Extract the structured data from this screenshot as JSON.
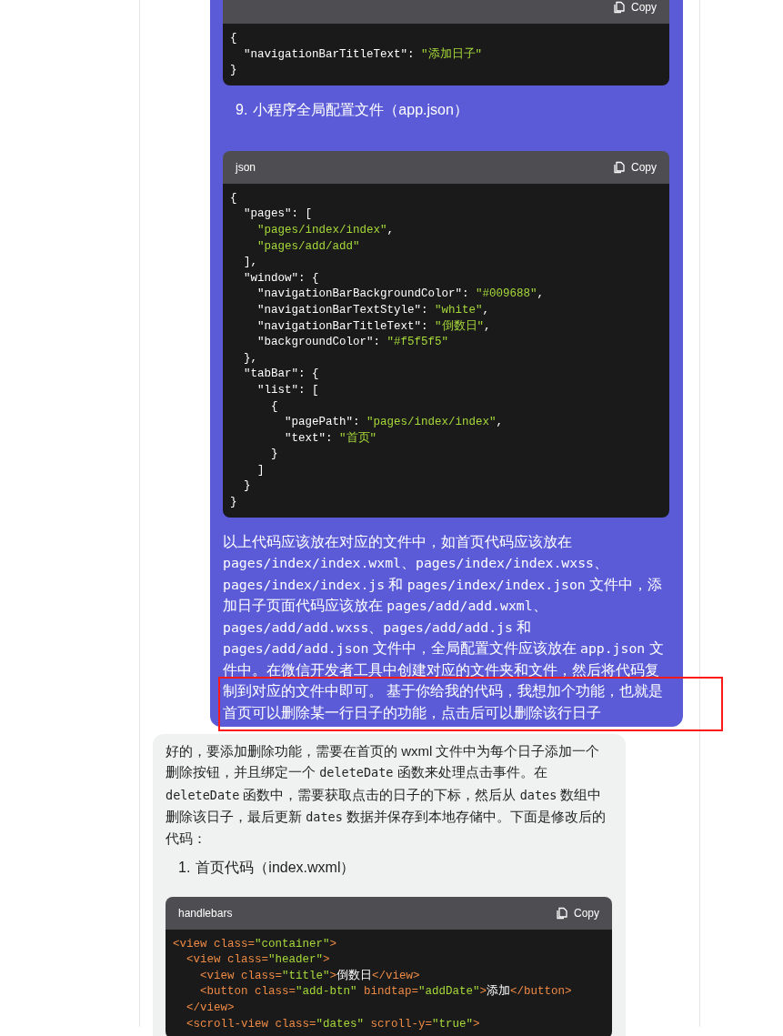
{
  "user_message": {
    "blocks": [
      {
        "kind": "code",
        "copy_label": "Copy",
        "lines": [
          [
            {
              "kind": "plain",
              "text": "{"
            }
          ],
          [
            {
              "kind": "plain",
              "text": "  \"navigationBarTitleText\": "
            },
            {
              "kind": "string",
              "text": "\"添加日子\""
            }
          ],
          [
            {
              "kind": "plain",
              "text": "}"
            }
          ]
        ]
      },
      {
        "kind": "list_item",
        "number": "9.",
        "text": "小程序全局配置文件（app.json）"
      },
      {
        "kind": "code",
        "language": "json",
        "copy_label": "Copy",
        "lines": [
          [
            {
              "kind": "plain",
              "text": "{"
            }
          ],
          [
            {
              "kind": "plain",
              "text": "  \"pages\": ["
            }
          ],
          [
            {
              "kind": "string",
              "text": "    \"pages/index/index\""
            },
            {
              "kind": "plain",
              "text": ","
            }
          ],
          [
            {
              "kind": "string",
              "text": "    \"pages/add/add\""
            }
          ],
          [
            {
              "kind": "plain",
              "text": "  ],"
            }
          ],
          [
            {
              "kind": "plain",
              "text": "  \"window\": {"
            }
          ],
          [
            {
              "kind": "plain",
              "text": "    \"navigationBarBackgroundColor\": "
            },
            {
              "kind": "string",
              "text": "\"#009688\""
            },
            {
              "kind": "plain",
              "text": ","
            }
          ],
          [
            {
              "kind": "plain",
              "text": "    \"navigationBarTextStyle\": "
            },
            {
              "kind": "string",
              "text": "\"white\""
            },
            {
              "kind": "plain",
              "text": ","
            }
          ],
          [
            {
              "kind": "plain",
              "text": "    \"navigationBarTitleText\": "
            },
            {
              "kind": "string",
              "text": "\"倒数日\""
            },
            {
              "kind": "plain",
              "text": ","
            }
          ],
          [
            {
              "kind": "plain",
              "text": "    \"backgroundColor\": "
            },
            {
              "kind": "string",
              "text": "\"#f5f5f5\""
            }
          ],
          [
            {
              "kind": "plain",
              "text": "  },"
            }
          ],
          [
            {
              "kind": "plain",
              "text": "  \"tabBar\": {"
            }
          ],
          [
            {
              "kind": "plain",
              "text": "    \"list\": ["
            }
          ],
          [
            {
              "kind": "plain",
              "text": "      {"
            }
          ],
          [
            {
              "kind": "plain",
              "text": "        \"pagePath\": "
            },
            {
              "kind": "string",
              "text": "\"pages/index/index\""
            },
            {
              "kind": "plain",
              "text": ","
            }
          ],
          [
            {
              "kind": "plain",
              "text": "        \"text\": "
            },
            {
              "kind": "string",
              "text": "\"首页\""
            }
          ],
          [
            {
              "kind": "plain",
              "text": "      }"
            }
          ],
          [
            {
              "kind": "plain",
              "text": "    ]"
            }
          ],
          [
            {
              "kind": "plain",
              "text": "  }"
            }
          ],
          [
            {
              "kind": "plain",
              "text": "}"
            }
          ]
        ]
      },
      {
        "kind": "paragraph",
        "segments": [
          {
            "kind": "text",
            "text": "以上代码应该放在对应的文件中，如首页代码应该放在 "
          },
          {
            "kind": "code",
            "text": "pages/index/index.wxml"
          },
          {
            "kind": "text",
            "text": "、"
          },
          {
            "kind": "code",
            "text": "pages/index/index.wxss"
          },
          {
            "kind": "text",
            "text": "、"
          },
          {
            "kind": "code",
            "text": "pages/index/index.js"
          },
          {
            "kind": "text",
            "text": " 和 "
          },
          {
            "kind": "code",
            "text": "pages/index/index.json"
          },
          {
            "kind": "text",
            "text": " 文件中，添加日子页面代码应该放在 "
          },
          {
            "kind": "code",
            "text": "pages/add/add.wxml"
          },
          {
            "kind": "text",
            "text": "、"
          },
          {
            "kind": "code",
            "text": "pages/add/add.wxss"
          },
          {
            "kind": "text",
            "text": "、"
          },
          {
            "kind": "code",
            "text": "pages/add/add.js"
          },
          {
            "kind": "text",
            "text": " 和 "
          },
          {
            "kind": "code",
            "text": "pages/add/add.json"
          },
          {
            "kind": "text",
            "text": " 文件中，全局配置文件应该放在 "
          },
          {
            "kind": "code",
            "text": "app.json"
          },
          {
            "kind": "text",
            "text": " 文件中。在微信开发者工具中创建对应的文件夹和文件，然后将代码复制到对应的文件中即可。 基于你给我的代码，我想加个功能，也就是首页可以删除某一行日子的功能，点击后可以删除该行日子"
          }
        ]
      }
    ]
  },
  "assistant_message": {
    "blocks": [
      {
        "kind": "paragraph",
        "segments": [
          {
            "kind": "text",
            "text": "好的，要添加删除功能，需要在首页的 wxml 文件中为每个日子添加一个删除按钮，并且绑定一个 "
          },
          {
            "kind": "code",
            "text": "deleteDate"
          },
          {
            "kind": "text",
            "text": " 函数来处理点击事件。在 "
          },
          {
            "kind": "code",
            "text": "deleteDate"
          },
          {
            "kind": "text",
            "text": " 函数中，需要获取点击的日子的下标，然后从 "
          },
          {
            "kind": "code",
            "text": "dates"
          },
          {
            "kind": "text",
            "text": " 数组中删除该日子，最后更新 "
          },
          {
            "kind": "code",
            "text": "dates"
          },
          {
            "kind": "text",
            "text": " 数据并保存到本地存储中。下面是修改后的代码："
          }
        ]
      },
      {
        "kind": "list_item",
        "number": "1.",
        "text": "首页代码（index.wxml）"
      },
      {
        "kind": "code",
        "language": "handlebars",
        "copy_label": "Copy",
        "lines": [
          [
            {
              "kind": "tag",
              "text": "<view class="
            },
            {
              "kind": "string",
              "text": "\"container\""
            },
            {
              "kind": "tag",
              "text": ">"
            }
          ],
          [
            {
              "kind": "tag",
              "text": "  <view class="
            },
            {
              "kind": "string",
              "text": "\"header\""
            },
            {
              "kind": "tag",
              "text": ">"
            }
          ],
          [
            {
              "kind": "tag",
              "text": "    <view class="
            },
            {
              "kind": "string",
              "text": "\"title\""
            },
            {
              "kind": "tag",
              "text": ">"
            },
            {
              "kind": "plain",
              "text": "倒数日"
            },
            {
              "kind": "tag",
              "text": "</view>"
            }
          ],
          [
            {
              "kind": "tag",
              "text": "    <button class="
            },
            {
              "kind": "string",
              "text": "\"add-btn\""
            },
            {
              "kind": "tag",
              "text": " bindtap="
            },
            {
              "kind": "string",
              "text": "\"addDate\""
            },
            {
              "kind": "tag",
              "text": ">"
            },
            {
              "kind": "plain",
              "text": "添加"
            },
            {
              "kind": "tag",
              "text": "</button>"
            }
          ],
          [
            {
              "kind": "tag",
              "text": "  </view>"
            }
          ],
          [
            {
              "kind": "tag",
              "text": "  <scroll-view class="
            },
            {
              "kind": "string",
              "text": "\"dates\""
            },
            {
              "kind": "tag",
              "text": " scroll-y="
            },
            {
              "kind": "string",
              "text": "\"true\""
            },
            {
              "kind": "tag",
              "text": ">"
            }
          ]
        ]
      }
    ]
  }
}
